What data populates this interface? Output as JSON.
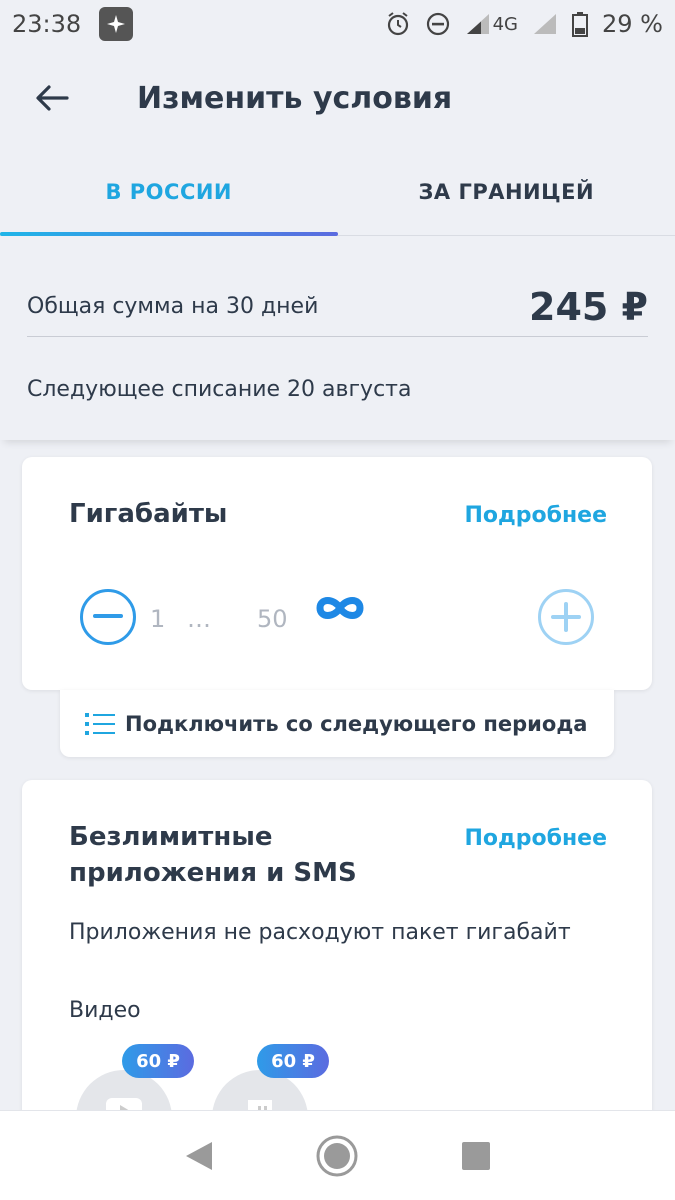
{
  "status_bar": {
    "time": "23:38",
    "network": "4G",
    "battery": "29 %"
  },
  "header": {
    "title": "Изменить условия"
  },
  "tabs": [
    {
      "label": "В РОССИИ",
      "active": true
    },
    {
      "label": "ЗА ГРАНИЦЕЙ",
      "active": false
    }
  ],
  "summary": {
    "total_label": "Общая сумма на 30 дней",
    "total_amount": "245 ₽",
    "next_charge": "Следующее списание 20 августа"
  },
  "gigabytes": {
    "title": "Гигабайты",
    "details_link": "Подробнее",
    "stepper_values": [
      "1",
      "…",
      "50"
    ],
    "next_period_label": "Подключить со следующего периода"
  },
  "unlimited_apps": {
    "title_line1": "Безлимитные",
    "title_line2": "приложения и SMS",
    "details_link": "Подробнее",
    "description": "Приложения не расходуют пакет гигабайт",
    "video_label": "Видео",
    "apps": [
      {
        "icon": "youtube-icon",
        "price": "60 ₽"
      },
      {
        "icon": "twitch-icon",
        "price": "60 ₽"
      }
    ]
  },
  "colors": {
    "accent": "#1fa6e0",
    "gradient_end": "#5b6be0",
    "text": "#2e3a4a",
    "background": "#eef0f5"
  }
}
